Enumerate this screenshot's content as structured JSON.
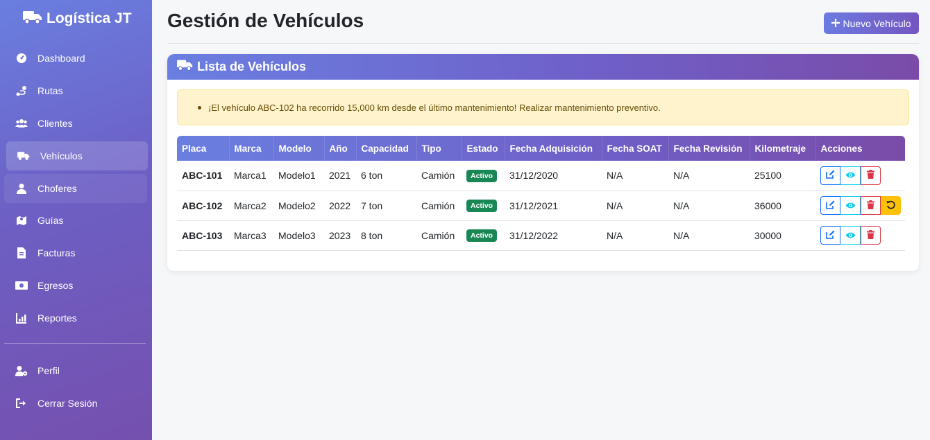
{
  "app": {
    "brand": "Logística JT"
  },
  "sidebar": {
    "items": [
      {
        "label": "Dashboard",
        "icon": "gauge-icon"
      },
      {
        "label": "Rutas",
        "icon": "route-icon"
      },
      {
        "label": "Clientes",
        "icon": "users-icon"
      },
      {
        "label": "Vehículos",
        "icon": "truck-icon",
        "active": true
      },
      {
        "label": "Choferes",
        "icon": "user-icon"
      },
      {
        "label": "Guías",
        "icon": "map-icon"
      },
      {
        "label": "Facturas",
        "icon": "invoice-icon"
      },
      {
        "label": "Egresos",
        "icon": "money-icon"
      },
      {
        "label": "Reportes",
        "icon": "chart-icon"
      }
    ],
    "bottom_items": [
      {
        "label": "Perfil",
        "icon": "user-cog-icon"
      },
      {
        "label": "Cerrar Sesión",
        "icon": "logout-icon"
      }
    ]
  },
  "header": {
    "title": "Gestión de Vehículos",
    "new_button": "Nuevo Vehículo"
  },
  "card": {
    "title": "Lista de Vehículos",
    "alert": "¡El vehículo ABC-102 ha recorrido 15,000 km desde el último mantenimiento! Realizar mantenimiento preventivo."
  },
  "table": {
    "columns": [
      "Placa",
      "Marca",
      "Modelo",
      "Año",
      "Capacidad",
      "Tipo",
      "Estado",
      "Fecha Adquisición",
      "Fecha SOAT",
      "Fecha Revisión",
      "Kilometraje",
      "Acciones"
    ],
    "rows": [
      {
        "placa": "ABC-101",
        "marca": "Marca1",
        "modelo": "Modelo1",
        "anio": "2021",
        "capacidad": "6 ton",
        "tipo": "Camión",
        "estado": "Activo",
        "fecha_adquisicion": "31/12/2020",
        "fecha_soat": "N/A",
        "fecha_revision": "N/A",
        "kilometraje": "25100",
        "restore": false
      },
      {
        "placa": "ABC-102",
        "marca": "Marca2",
        "modelo": "Modelo2",
        "anio": "2022",
        "capacidad": "7 ton",
        "tipo": "Camión",
        "estado": "Activo",
        "fecha_adquisicion": "31/12/2021",
        "fecha_soat": "N/A",
        "fecha_revision": "N/A",
        "kilometraje": "36000",
        "restore": true
      },
      {
        "placa": "ABC-103",
        "marca": "Marca3",
        "modelo": "Modelo3",
        "anio": "2023",
        "capacidad": "8 ton",
        "tipo": "Camión",
        "estado": "Activo",
        "fecha_adquisicion": "31/12/2022",
        "fecha_soat": "N/A",
        "fecha_revision": "N/A",
        "kilometraje": "30000",
        "restore": false
      }
    ]
  },
  "colors": {
    "accent_start": "#6a7fe0",
    "accent_end": "#7a4ca8",
    "active_badge": "#198754",
    "edit": "#0d6efd",
    "view": "#0dcaf0",
    "delete": "#dc3545",
    "restore": "#ffc107",
    "alert_bg": "#fff3cd"
  }
}
